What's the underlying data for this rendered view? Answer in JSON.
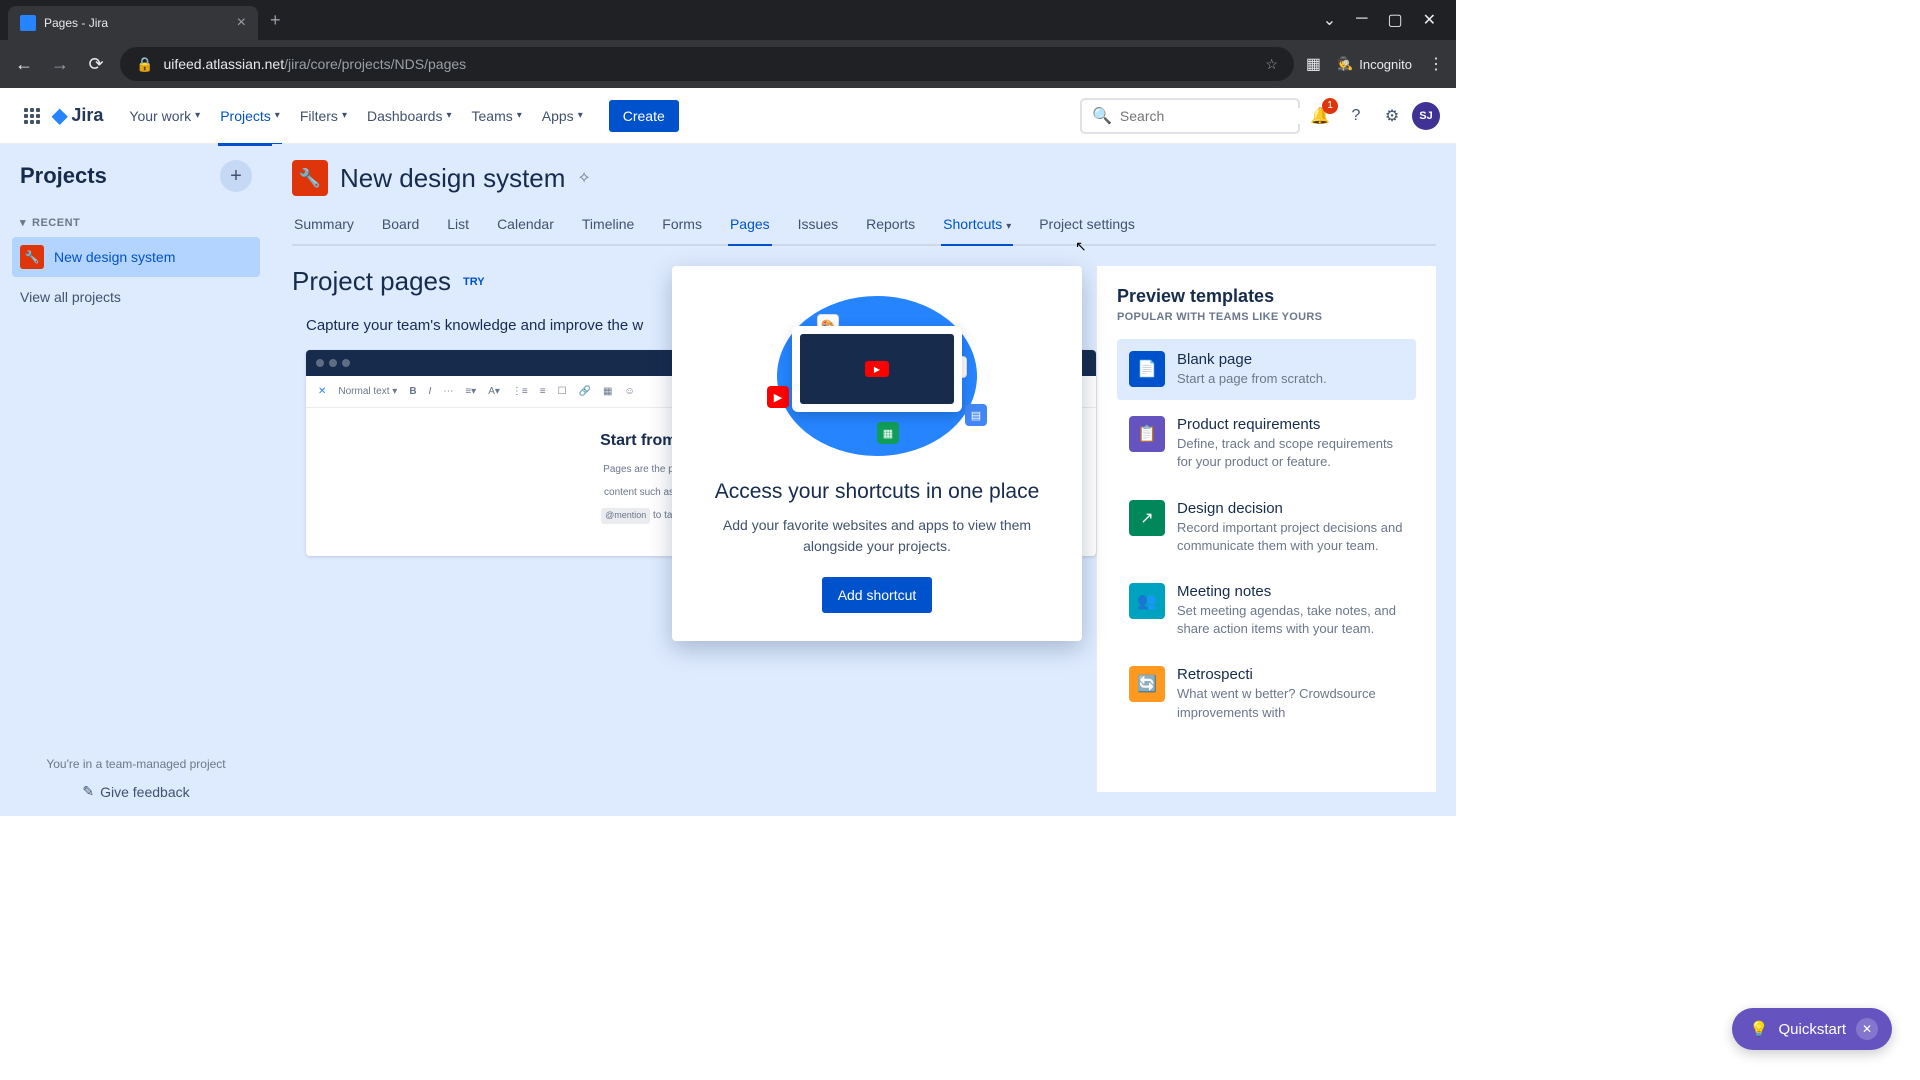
{
  "browser": {
    "tab_title": "Pages - Jira",
    "url_host": "uifeed.atlassian.net",
    "url_path": "/jira/core/projects/NDS/pages",
    "incognito_label": "Incognito"
  },
  "nav": {
    "items": [
      "Your work",
      "Projects",
      "Filters",
      "Dashboards",
      "Teams",
      "Apps"
    ],
    "active_index": 1,
    "create_label": "Create",
    "search_placeholder": "Search",
    "notification_count": "1",
    "avatar_initials": "SJ"
  },
  "sidebar": {
    "title": "Projects",
    "recent_label": "RECENT",
    "projects": [
      {
        "name": "New design system",
        "selected": true
      }
    ],
    "view_all": "View all projects",
    "footer_text": "You're in a team-managed project",
    "feedback": "Give feedback"
  },
  "project": {
    "name": "New design system",
    "tabs": [
      "Summary",
      "Board",
      "List",
      "Calendar",
      "Timeline",
      "Forms",
      "Pages",
      "Issues",
      "Reports",
      "Shortcuts",
      "Project settings"
    ],
    "active_tab_index": 6,
    "hover_tab_index": 9
  },
  "pages": {
    "title": "Project pages",
    "try_badge": "TRY",
    "capture_text": "Capture your team's knowledge and improve the w",
    "editor_heading": "Start from scratch with a b",
    "editor_p1": "Pages are the place to capture all your impo",
    "editor_p2": "content such as tasks, images, macros, Jira",
    "editor_mention": "@mention",
    "editor_p3": "to tag your teammates and collab"
  },
  "popover": {
    "title": "Access your shortcuts in one place",
    "desc": "Add your favorite websites and apps to view them alongside your projects.",
    "button": "Add shortcut"
  },
  "templates": {
    "title": "Preview templates",
    "subtitle": "POPULAR WITH TEAMS LIKE YOURS",
    "items": [
      {
        "name": "Blank page",
        "desc": "Start a page from scratch.",
        "color": "blue",
        "selected": true
      },
      {
        "name": "Product requirements",
        "desc": "Define, track and scope requirements for your product or feature.",
        "color": "purple",
        "selected": false
      },
      {
        "name": "Design decision",
        "desc": "Record important project decisions and communicate them with your team.",
        "color": "green",
        "selected": false
      },
      {
        "name": "Meeting notes",
        "desc": "Set meeting agendas, take notes, and share action items with your team.",
        "color": "teal",
        "selected": false
      },
      {
        "name": "Retrospecti",
        "desc": "What went w                                     better? Crowdsource improvements with",
        "color": "orange",
        "selected": false
      }
    ]
  },
  "quickstart": {
    "label": "Quickstart"
  }
}
